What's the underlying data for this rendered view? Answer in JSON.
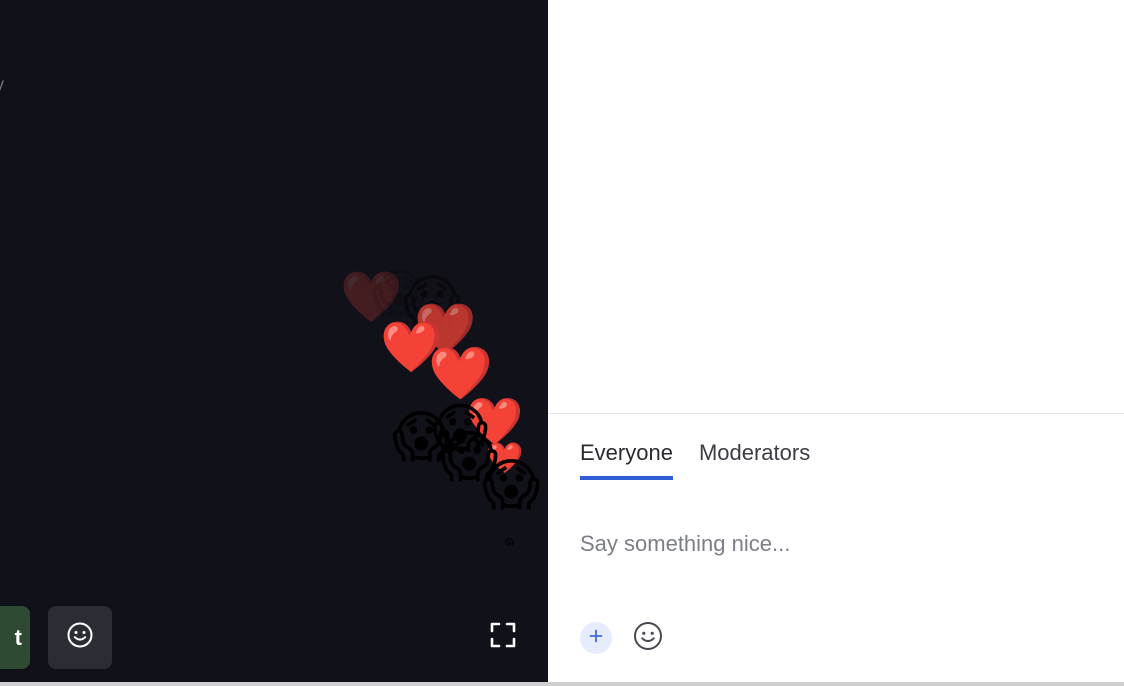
{
  "video": {
    "edge_glyph": "y",
    "cut_button_label": "t",
    "reaction_button_icon": "smiley-icon",
    "fullscreen_icon": "fullscreen-icon",
    "floating_reactions": [
      {
        "emoji": "❤️",
        "name": "heart-icon"
      },
      {
        "emoji": "😱",
        "name": "scream-emoji"
      }
    ]
  },
  "chat": {
    "tabs": [
      {
        "label": "Everyone",
        "active": true
      },
      {
        "label": "Moderators",
        "active": false
      }
    ],
    "input_placeholder": "Say something nice...",
    "add_icon": "plus-icon",
    "emoji_icon": "smiley-icon"
  },
  "colors": {
    "video_bg": "#11111a",
    "accent": "#2f5fd6",
    "cut_button_bg": "#2f4a33"
  }
}
